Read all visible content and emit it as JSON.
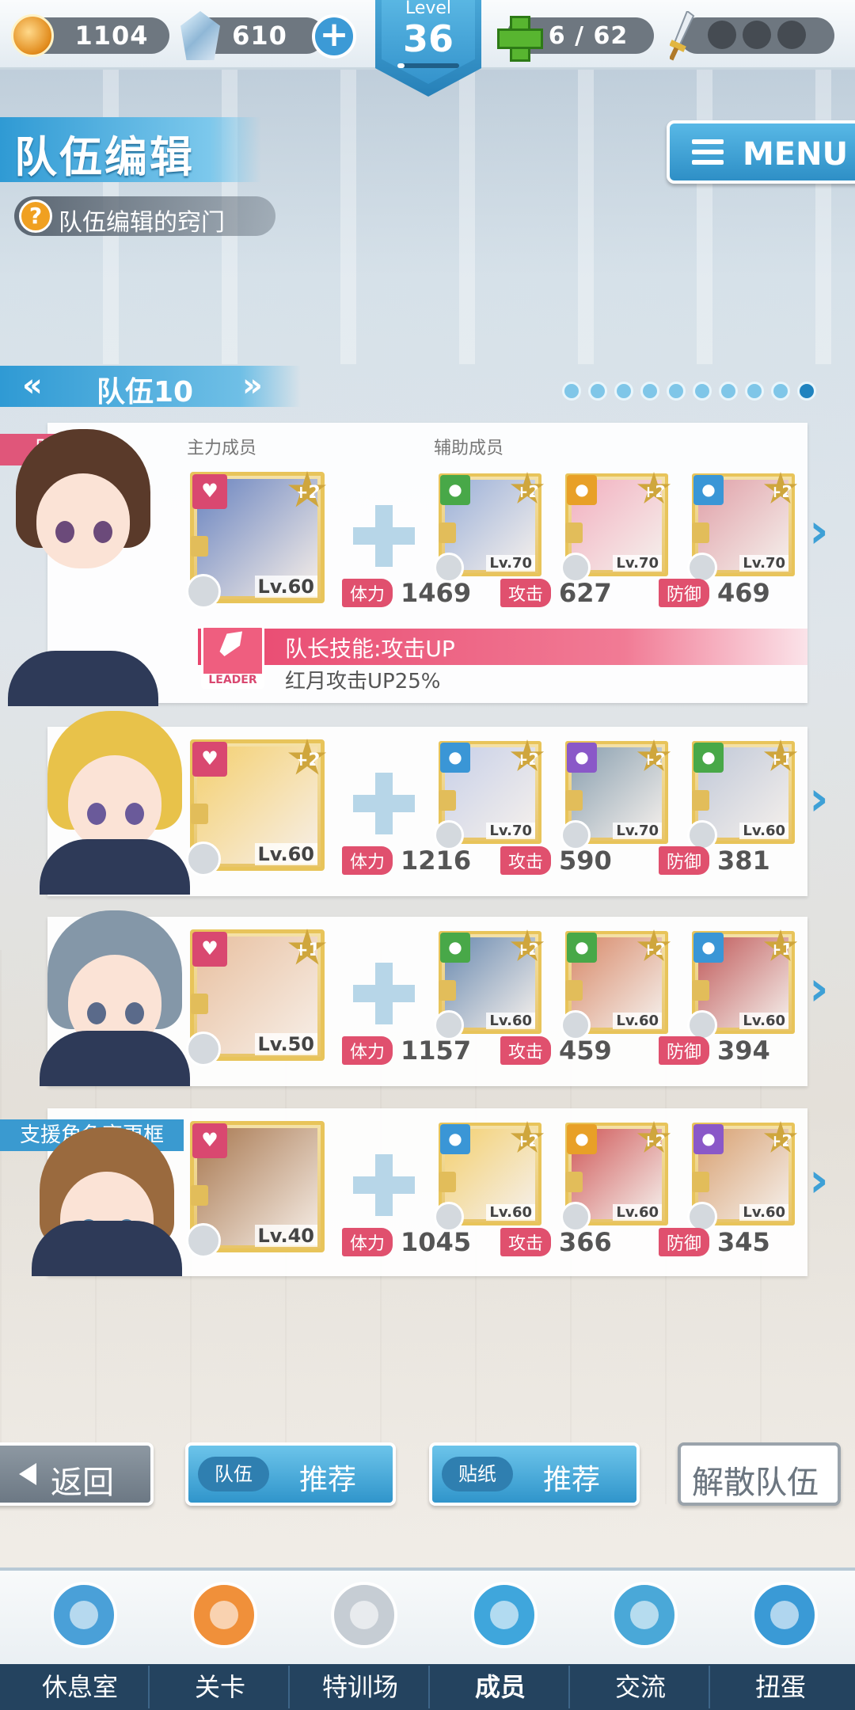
{
  "topbar": {
    "coins": "1104",
    "gems": "610",
    "level_label": "Level",
    "level": "36",
    "level_progress": 0.12,
    "stamina": "6",
    "stamina_max": "/ 62",
    "stamina_text": "6  / 62"
  },
  "header": {
    "title": "队伍编辑",
    "hint": "队伍编辑的窍门",
    "menu_label": "MENU"
  },
  "team": {
    "name": "队伍10",
    "page_count": 10,
    "active_page": 10,
    "col_main": "主力成员",
    "col_support": "辅助成员",
    "leader_tag": "队长",
    "support_tag": "支援角色变更框",
    "stat_labels": {
      "hp": "体力",
      "atk": "攻击",
      "def": "防御"
    },
    "leader_skill_badge": "LEADER",
    "leader_skill": "队长技能:攻击UP",
    "leader_skill_desc": "红月攻击UP25%",
    "rows": [
      {
        "main": {
          "level": "Lv.60",
          "plus": "+2",
          "attr": "red"
        },
        "supports": [
          {
            "level": "Lv.70",
            "plus": "+2",
            "attr": "green"
          },
          {
            "level": "Lv.70",
            "plus": "+2",
            "attr": "orange"
          },
          {
            "level": "Lv.70",
            "plus": "+2",
            "attr": "blue"
          }
        ],
        "hp": "1469",
        "atk": "627",
        "def": "469"
      },
      {
        "main": {
          "level": "Lv.60",
          "plus": "+2",
          "attr": "red"
        },
        "supports": [
          {
            "level": "Lv.70",
            "plus": "+2",
            "attr": "blue"
          },
          {
            "level": "Lv.70",
            "plus": "+2",
            "attr": "purple"
          },
          {
            "level": "Lv.60",
            "plus": "+1",
            "attr": "green"
          }
        ],
        "hp": "1216",
        "atk": "590",
        "def": "381"
      },
      {
        "main": {
          "level": "Lv.50",
          "plus": "+1",
          "attr": "red"
        },
        "supports": [
          {
            "level": "Lv.60",
            "plus": "+2",
            "attr": "green"
          },
          {
            "level": "Lv.60",
            "plus": "+2",
            "attr": "green"
          },
          {
            "level": "Lv.60",
            "plus": "+1",
            "attr": "blue"
          }
        ],
        "hp": "1157",
        "atk": "459",
        "def": "394"
      },
      {
        "main": {
          "level": "Lv.40",
          "plus": "",
          "attr": "red"
        },
        "supports": [
          {
            "level": "Lv.60",
            "plus": "+2",
            "attr": "blue"
          },
          {
            "level": "Lv.60",
            "plus": "+2",
            "attr": "orange"
          },
          {
            "level": "Lv.60",
            "plus": "+2",
            "attr": "purple"
          }
        ],
        "hp": "1045",
        "atk": "366",
        "def": "345"
      }
    ]
  },
  "actions": {
    "back": "返回",
    "team_recommend_tag": "队伍",
    "team_recommend": "推荐",
    "sticker_recommend_tag": "贴纸",
    "sticker_recommend": "推荐",
    "disband": "解散队伍"
  },
  "nav": [
    {
      "label": "休息室",
      "icon": "school-icon"
    },
    {
      "label": "关卡",
      "icon": "monster-icon"
    },
    {
      "label": "特训场",
      "icon": "crossed-swords-icon"
    },
    {
      "label": "成员",
      "icon": "cat-mascot-icon",
      "active": true
    },
    {
      "label": "交流",
      "icon": "dress-icon"
    },
    {
      "label": "扭蛋",
      "icon": "curtain-stage-icon"
    }
  ],
  "colors": {
    "accent": "#3095cb",
    "stat_badge": "#e0506e",
    "leader": "#e8466e"
  }
}
